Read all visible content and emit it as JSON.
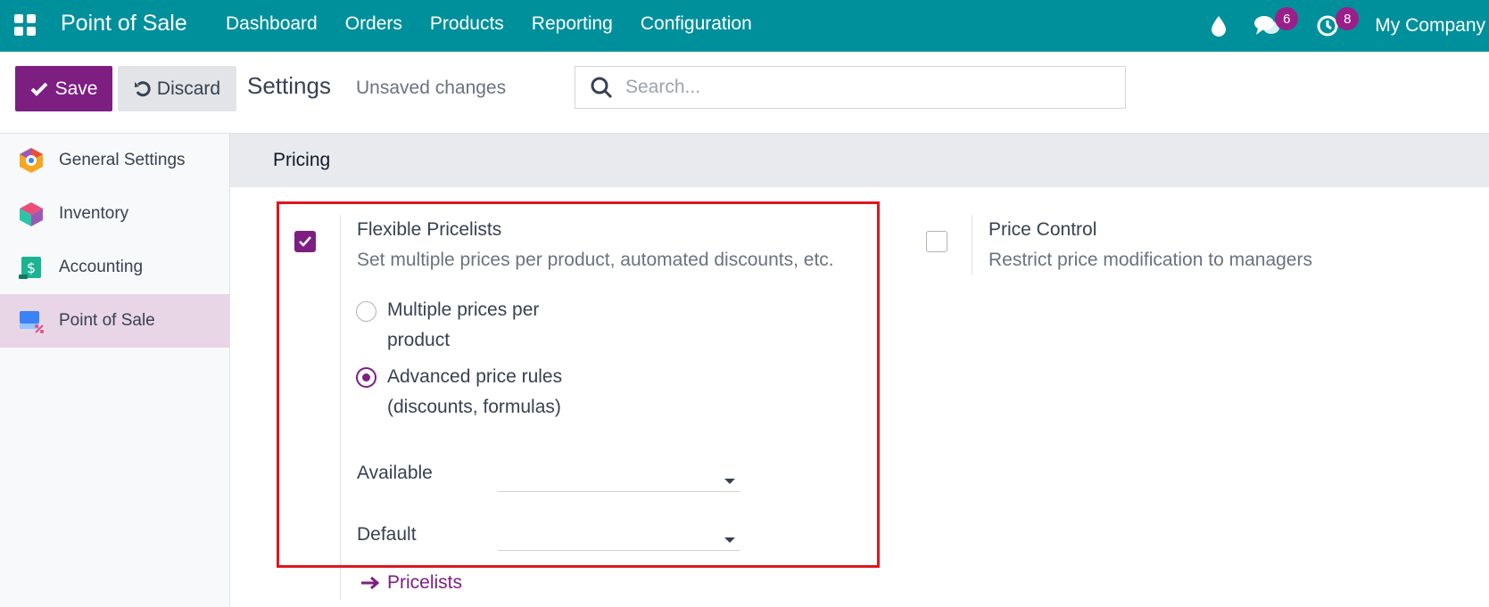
{
  "navbar": {
    "brand": "Point of Sale",
    "menu": [
      "Dashboard",
      "Orders",
      "Products",
      "Reporting",
      "Configuration"
    ],
    "chat_count": "6",
    "activity_count": "8",
    "company": "My Company"
  },
  "control": {
    "save_label": "Save",
    "discard_label": "Discard",
    "title": "Settings",
    "status": "Unsaved changes",
    "search_placeholder": "Search..."
  },
  "sidebar": {
    "items": [
      {
        "label": "General Settings",
        "icon": "general-settings-icon"
      },
      {
        "label": "Inventory",
        "icon": "inventory-icon"
      },
      {
        "label": "Accounting",
        "icon": "accounting-icon"
      },
      {
        "label": "Point of Sale",
        "icon": "point-of-sale-icon",
        "active": true
      }
    ]
  },
  "section": {
    "title": "Pricing"
  },
  "settings": {
    "flexible": {
      "title": "Flexible Pricelists",
      "description": "Set multiple prices per product, automated discounts, etc.",
      "checked": true,
      "options": [
        {
          "line1": "Multiple prices per",
          "line2": "product",
          "selected": false
        },
        {
          "line1": "Advanced price rules",
          "line2": "(discounts, formulas)",
          "selected": true
        }
      ],
      "available_label": "Available",
      "default_label": "Default",
      "available_value": "",
      "default_value": "",
      "link_label": "Pricelists"
    },
    "price_control": {
      "title": "Price Control",
      "description": "Restrict price modification to managers",
      "checked": false
    }
  },
  "colors": {
    "navbar": "#00909c",
    "primary": "#7c1f81",
    "highlight": "#e0161d",
    "active_sidebar": "#e8d5e6"
  }
}
